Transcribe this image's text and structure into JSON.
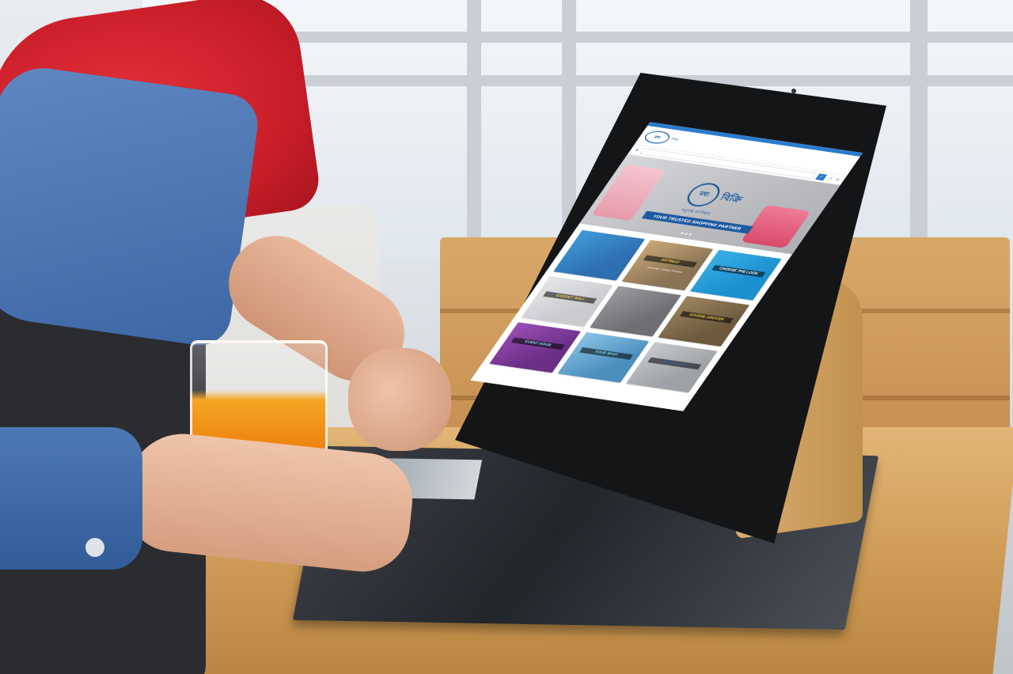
{
  "screen": {
    "header": {
      "logo_mark": "মধ্য",
      "logo_text": "বিক্রি"
    },
    "hero": {
      "brand_ring": "মধ্য",
      "brand": "বিক্রি",
      "subtitle": "নতুনত্ব আবিষ্কার",
      "tagline": "YOUR TRUSTED SHOPPING PARTNER"
    },
    "tiles": [
      {
        "label": "",
        "sub": "",
        "bg": "#2d6fb0",
        "accent": "#3f9ad8",
        "label_color": "#ffffff"
      },
      {
        "label": "ARTBEAT",
        "sub": "• Handicrafts • Clothing • Decoration",
        "bg": "#8b7455",
        "accent": "#c9a877",
        "label_color": "#f2c94c"
      },
      {
        "label": "CHOOSE THE LOOK",
        "sub": "",
        "bg": "#1c8fcf",
        "accent": "#3ab0e6",
        "label_color": "#ffffff"
      },
      {
        "label": "GADGET WALI",
        "sub": "",
        "bg": "#c9cbce",
        "accent": "#e4e6e8",
        "label_color": "#f2c94c"
      },
      {
        "label": "",
        "sub": "",
        "bg": "#6e6f72",
        "accent": "#9a9b9e",
        "label_color": "#e95a8a"
      },
      {
        "label": "GOODIE GROCER",
        "sub": "",
        "bg": "#6d5a3e",
        "accent": "#9c8560",
        "label_color": "#f2c94c"
      },
      {
        "label": "EVENT HOUR",
        "sub": "",
        "bg": "#6b2f86",
        "accent": "#9a4fb6",
        "label_color": "#7be0f0"
      },
      {
        "label": "TOUR SPOT",
        "sub": "",
        "bg": "#4b8fbf",
        "accent": "#8ac3e4",
        "label_color": "#7be0f0"
      },
      {
        "label": "MOTO MAXX",
        "sub": "",
        "bg": "#9ea1a5",
        "accent": "#c8cacc",
        "label_color": "#2d5fb0"
      }
    ]
  }
}
